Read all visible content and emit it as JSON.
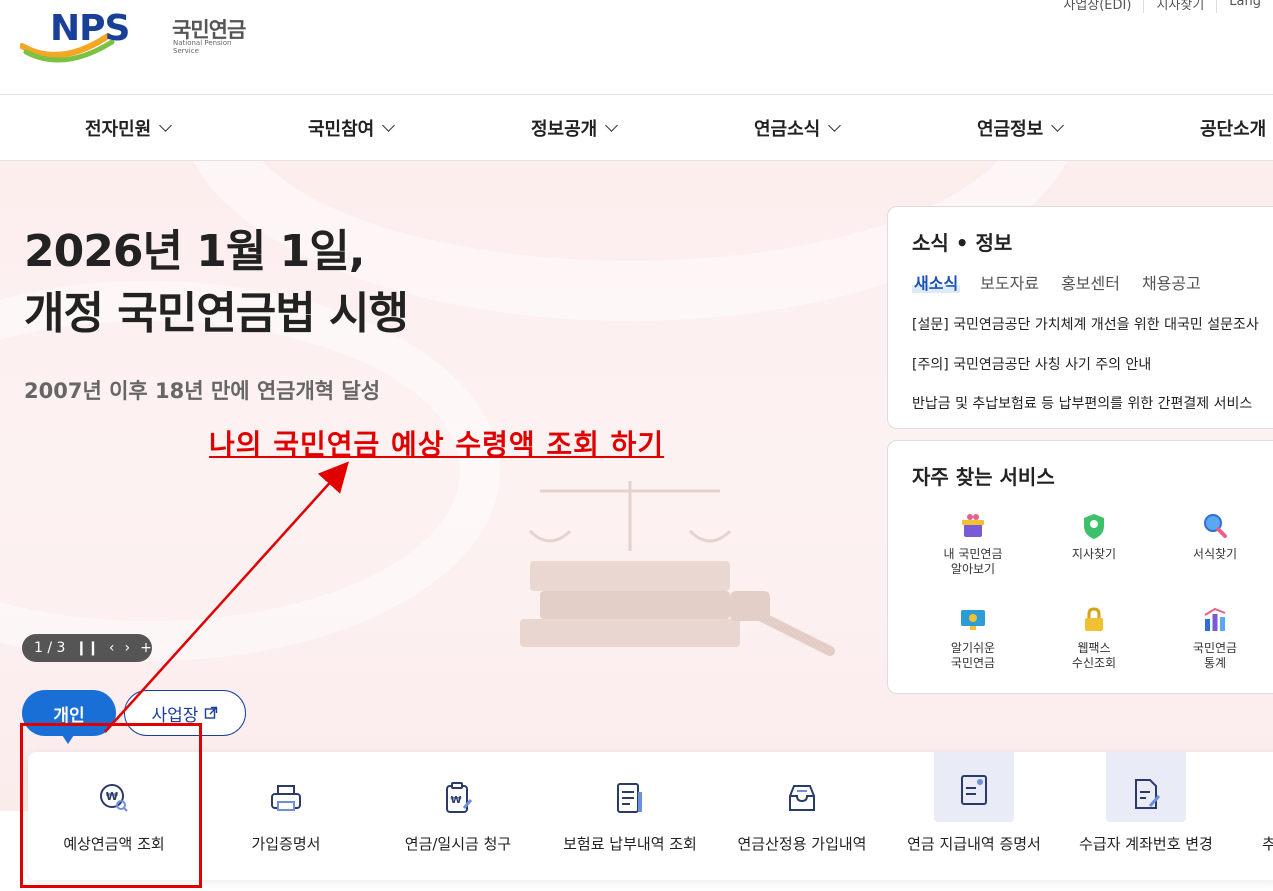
{
  "header": {
    "logo_text": "NPS",
    "logo_korean": "국민연금",
    "logo_english": "National Pension Service",
    "utility": [
      "사업장(EDI)",
      "지사찾기",
      "Lang"
    ]
  },
  "nav": {
    "items": [
      "전자민원",
      "국민참여",
      "정보공개",
      "연금소식",
      "연금정보",
      "공단소개"
    ]
  },
  "hero": {
    "title_line1": "2026년 1월 1일,",
    "title_line2": "개정 국민연금법 시행",
    "subtitle": "2007년 이후 18년 만에 연금개혁 달성",
    "slider_counter": "1 / 3",
    "tab_personal": "개인",
    "tab_business": "사업장"
  },
  "annotation": {
    "text": "나의 국민연금 예상 수령액 조회 하기",
    "color": "#e00000"
  },
  "news": {
    "title": "소식 • 정보",
    "tabs": [
      "새소식",
      "보도자료",
      "홍보센터",
      "채용공고"
    ],
    "active_tab": "새소식",
    "items": [
      "[설문] 국민연금공단 가치체계 개선을 위한 대국민 설문조사",
      "[주의] 국민연금공단 사칭 사기 주의 안내",
      "반납금 및 추납보험료 등 납부편의를 위한 간편결제 서비스"
    ]
  },
  "services": {
    "title": "자주 찾는 서비스",
    "items": [
      {
        "line1": "내 국민연금",
        "line2": "알아보기",
        "icon": "gift-icon"
      },
      {
        "line1": "지사찾기",
        "line2": "",
        "icon": "shield-icon"
      },
      {
        "line1": "서식찾기",
        "line2": "",
        "icon": "magnifier-icon"
      },
      {
        "line1": "알기쉬운",
        "line2": "국민연금",
        "icon": "monitor-icon"
      },
      {
        "line1": "웹팩스",
        "line2": "수신조회",
        "icon": "lock-icon"
      },
      {
        "line1": "국민연금",
        "line2": "통계",
        "icon": "chart-icon"
      }
    ]
  },
  "quick_menu": {
    "items": [
      {
        "label": "예상연금액 조회",
        "icon": "won-search-icon"
      },
      {
        "label": "가입증명서",
        "icon": "printer-icon"
      },
      {
        "label": "연금/일시금 청구",
        "icon": "clipboard-won-icon"
      },
      {
        "label": "보험료 납부내역 조회",
        "icon": "document-icon"
      },
      {
        "label": "연금산정용 가입내역",
        "icon": "mailbox-icon"
      },
      {
        "label": "연금 지급내역 증명서",
        "icon": "certificate-icon"
      },
      {
        "label": "수급자 계좌번호 변경",
        "icon": "edit-document-icon"
      },
      {
        "label": "추",
        "icon": "more-icon"
      }
    ]
  },
  "colors": {
    "brand_blue": "#1a3f99",
    "accent_blue": "#1a6fd6",
    "hero_bg": "#fdeeee",
    "annotation_red": "#e00000"
  }
}
